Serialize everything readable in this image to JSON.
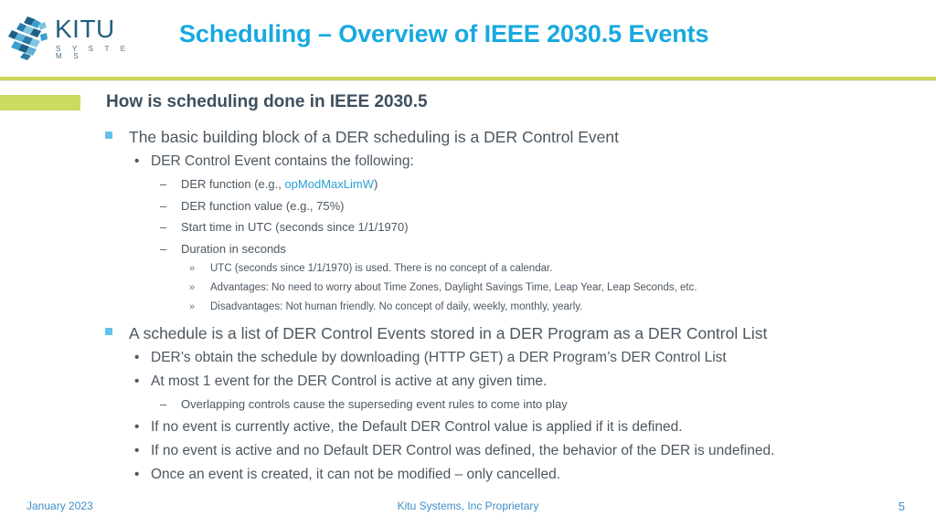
{
  "header": {
    "logo": {
      "name": "KITU",
      "tagline": "S Y S T E M S",
      "icon": "kitu-network-logo"
    },
    "title": "Scheduling – Overview of IEEE 2030.5 Events",
    "title_color": "#17a9e0",
    "rule_color": "#c9d957"
  },
  "section": {
    "accent_color": "#cbdb5f",
    "heading": "How is scheduling done in IEEE 2030.5"
  },
  "content": {
    "b1": "The basic building block of a DER scheduling is a DER Control Event",
    "b1_1": "DER Control Event contains the following:",
    "b1_1_1_pre": "DER function (e.g., ",
    "b1_1_1_code": "opModMaxLimW",
    "b1_1_1_post": ")",
    "b1_1_2": "DER function value (e.g., 75%)",
    "b1_1_3": "Start time in UTC (seconds since 1/1/1970)",
    "b1_1_4": "Duration in seconds",
    "b1_1_4_1": "UTC (seconds since 1/1/1970) is used. There is no concept of a calendar.",
    "b1_1_4_2": "Advantages: No need to worry about Time Zones, Daylight Savings Time, Leap Year, Leap Seconds, etc.",
    "b1_1_4_3": "Disadvantages: Not human friendly. No concept of daily, weekly, monthly, yearly.",
    "b2": "A schedule is a list of DER Control Events stored in a DER Program as a DER Control List",
    "b2_1": "DER’s obtain the schedule by downloading (HTTP GET) a DER Program’s DER Control List",
    "b2_2": "At most 1 event for the DER Control is active at any given time.",
    "b2_2_1": "Overlapping controls cause the superseding event rules to come into play",
    "b2_3": "If no event is currently active, the Default DER Control value is applied if it is defined.",
    "b2_4": "If no event is active and no Default DER Control was defined, the behavior of the DER is undefined.",
    "b2_5": "Once an event is created, it can not be modified – only cancelled."
  },
  "markers": {
    "square": "",
    "dot": "•",
    "dash": "–",
    "chevron": "»"
  },
  "footer": {
    "date": "January 2023",
    "center": "Kitu Systems, Inc Proprietary",
    "page": "5",
    "color": "#3f8ec6"
  }
}
